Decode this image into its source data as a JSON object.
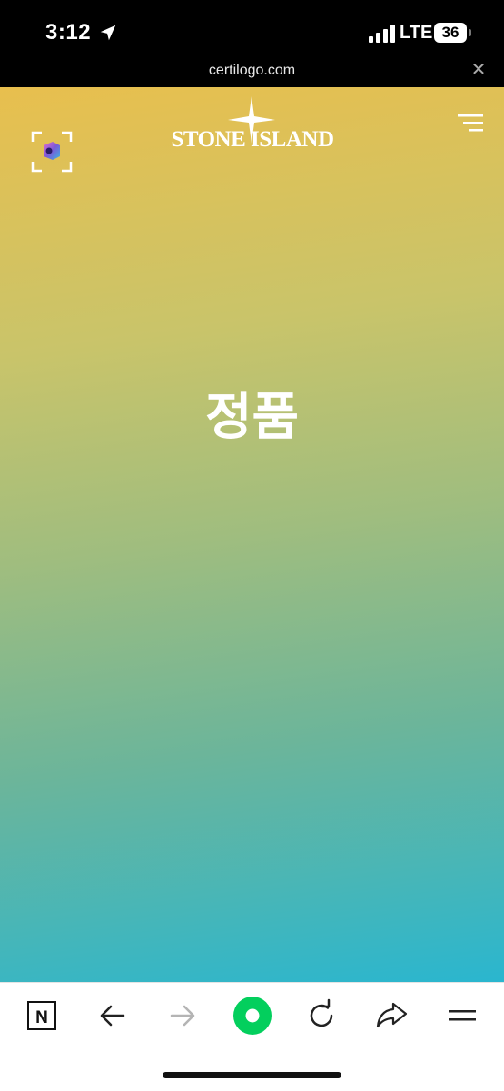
{
  "status_bar": {
    "time": "3:12",
    "network": "LTE",
    "battery": "36",
    "location_icon": "location-arrow-icon",
    "signal_icon": "cellular-signal-icon"
  },
  "browser": {
    "url": "certilogo.com",
    "close_icon": "close-icon",
    "close_glyph": "✕"
  },
  "page": {
    "logo_text": "STONE ISLAND",
    "logo_icon": "compass-star-icon",
    "scan_icon": "scan-icon",
    "menu_icon": "menu-icon",
    "main_text": "정품",
    "gradient_colors": [
      "#e8bf4e",
      "#c9c46a",
      "#9fbd7f",
      "#6cb59a",
      "#2ab6cf"
    ]
  },
  "toolbar": {
    "items": [
      {
        "icon": "naver-n-icon",
        "label": "N"
      },
      {
        "icon": "back-arrow-icon"
      },
      {
        "icon": "forward-arrow-icon"
      },
      {
        "icon": "green-home-icon",
        "color": "#03cf5d"
      },
      {
        "icon": "reload-icon"
      },
      {
        "icon": "share-icon"
      },
      {
        "icon": "menu-icon"
      }
    ]
  }
}
